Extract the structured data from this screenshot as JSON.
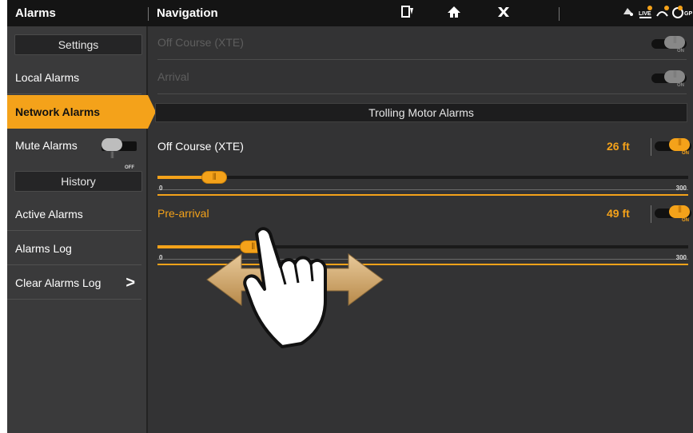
{
  "topbar": {
    "title": "Alarms",
    "navigation": "Navigation",
    "icons": [
      "waypoint-icon",
      "home-icon",
      "close-icon",
      "live-sonar-status-icon",
      "sonar-status-icon",
      "gps-status-icon"
    ],
    "gps_text": "GP"
  },
  "sidebar": {
    "settings_header": "Settings",
    "local_alarms": "Local Alarms",
    "network_alarms": "Network Alarms",
    "mute_alarms": "Mute Alarms",
    "mute_state": "OFF",
    "history_header": "History",
    "active_alarms": "Active Alarms",
    "alarms_log": "Alarms Log",
    "clear_alarms_log": "Clear Alarms Log",
    "chevron": ">"
  },
  "main": {
    "off_course_disabled": "Off Course (XTE)",
    "arrival_disabled": "Arrival",
    "disabled_toggle_state": "ON",
    "trolling_header": "Trolling Motor Alarms",
    "alarms": [
      {
        "label": "Off Course (XTE)",
        "value": "26 ft",
        "toggle": "ON",
        "min": "0",
        "max": "300",
        "position": 26
      },
      {
        "label": "Pre-arrival",
        "value": "49 ft",
        "toggle": "ON",
        "min": "0",
        "max": "300",
        "position": 49
      }
    ]
  },
  "colors": {
    "accent": "#f4a21a",
    "background": "#333334",
    "topbar": "#141414",
    "disabled_text": "#5e5e5e"
  }
}
